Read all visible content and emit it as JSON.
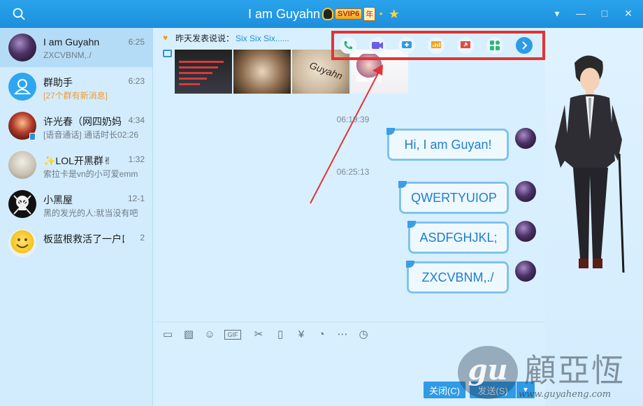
{
  "window": {
    "title": "I am Guyahn",
    "vip_badge": "SVIP6",
    "vip_year": "年",
    "controls": [
      "minimize",
      "maximize",
      "close"
    ]
  },
  "sidebar": {
    "conversations": [
      {
        "name": "I am Guyahn",
        "time": "6:25",
        "preview": "ZXCVBNM,./",
        "avatar": "dark-portrait",
        "active": true
      },
      {
        "name": "群助手",
        "time": "6:23",
        "preview": "[27个群有新消息]",
        "avatar": "group-assistant",
        "preview_color": "#f39b2a"
      },
      {
        "name": "许光春（网四奶妈",
        "time": "4:34",
        "preview": "[语音通话] 通话时长02:26",
        "avatar": "fire-portrait"
      },
      {
        "name": "✨LOL开黑群✌",
        "time": "1:32",
        "preview": "索拉卡是vn的小可爱emm",
        "avatar": "sketch-portrait"
      },
      {
        "name": "小黑屋",
        "time": "12-1",
        "preview": "黑的发光的人:就当没有吧",
        "avatar": "skull"
      },
      {
        "name": "板蓝根救活了一户口",
        "time": "2",
        "preview": "",
        "avatar": "smiley"
      }
    ]
  },
  "feed": {
    "status_label": "昨天发表说说：",
    "status_link": "Six Six Six......",
    "thumb_text": "Guyahn"
  },
  "toolbar": {
    "tools": [
      {
        "icon": "phone-icon",
        "color": "#27b36b"
      },
      {
        "icon": "video-icon",
        "color": "#6b5ee8"
      },
      {
        "icon": "add-screen-icon",
        "color": "#2f9ae6"
      },
      {
        "icon": "present-icon",
        "color": "#f4a21a"
      },
      {
        "icon": "screen-share-icon",
        "color": "#e8493f"
      },
      {
        "icon": "apps-icon",
        "color": "#2eb871"
      },
      {
        "icon": "more-arrow-icon",
        "color": "#2f9ae6"
      }
    ]
  },
  "messages": {
    "timestamps": [
      "06:19:39",
      "06:25:13"
    ],
    "items": [
      "Hi, I am Guyan!",
      "QWERTYUIOP",
      "ASDFGHJKL;",
      "ZXCVBNM,./"
    ]
  },
  "input_toolbar": {
    "icons": [
      "folder-icon",
      "image-icon",
      "emoji-icon",
      "gif-icon",
      "scissors-icon",
      "shake-icon",
      "red-packet-icon",
      "voice-icon",
      "more-icon",
      "history-icon"
    ],
    "gif_label": "GIF"
  },
  "buttons": {
    "close": "关闭(C)",
    "send": "发送(S)"
  },
  "watermark": {
    "logo": "gu",
    "title": "顧亞恆",
    "url": "www.guyaheng.com"
  }
}
